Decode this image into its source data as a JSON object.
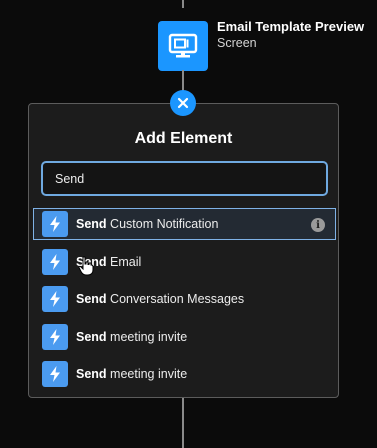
{
  "node": {
    "title": "Email Template Preview",
    "subtitle": "Screen",
    "icon": "screen-icon",
    "color": "#1b96ff"
  },
  "close_button": {
    "icon": "close-icon"
  },
  "panel": {
    "title": "Add Element",
    "search": {
      "value": "Send",
      "placeholder": ""
    },
    "results": [
      {
        "match": "Send",
        "rest": " Custom Notification",
        "icon": "lightning-bolt-icon",
        "selected": true,
        "info_icon": "info-icon"
      },
      {
        "match": "Send",
        "rest": " Email",
        "icon": "lightning-bolt-icon"
      },
      {
        "match": "Send",
        "rest": " Conversation Messages",
        "icon": "lightning-bolt-icon"
      },
      {
        "match": "Send",
        "rest": " meeting invite",
        "icon": "lightning-bolt-icon"
      },
      {
        "match": "Send",
        "rest": " meeting invite",
        "icon": "lightning-bolt-icon"
      }
    ]
  },
  "colors": {
    "accent": "#1b96ff",
    "background": "#0b0b0b",
    "panel": "#1c1c1c",
    "search_border": "#6fa9e0"
  }
}
